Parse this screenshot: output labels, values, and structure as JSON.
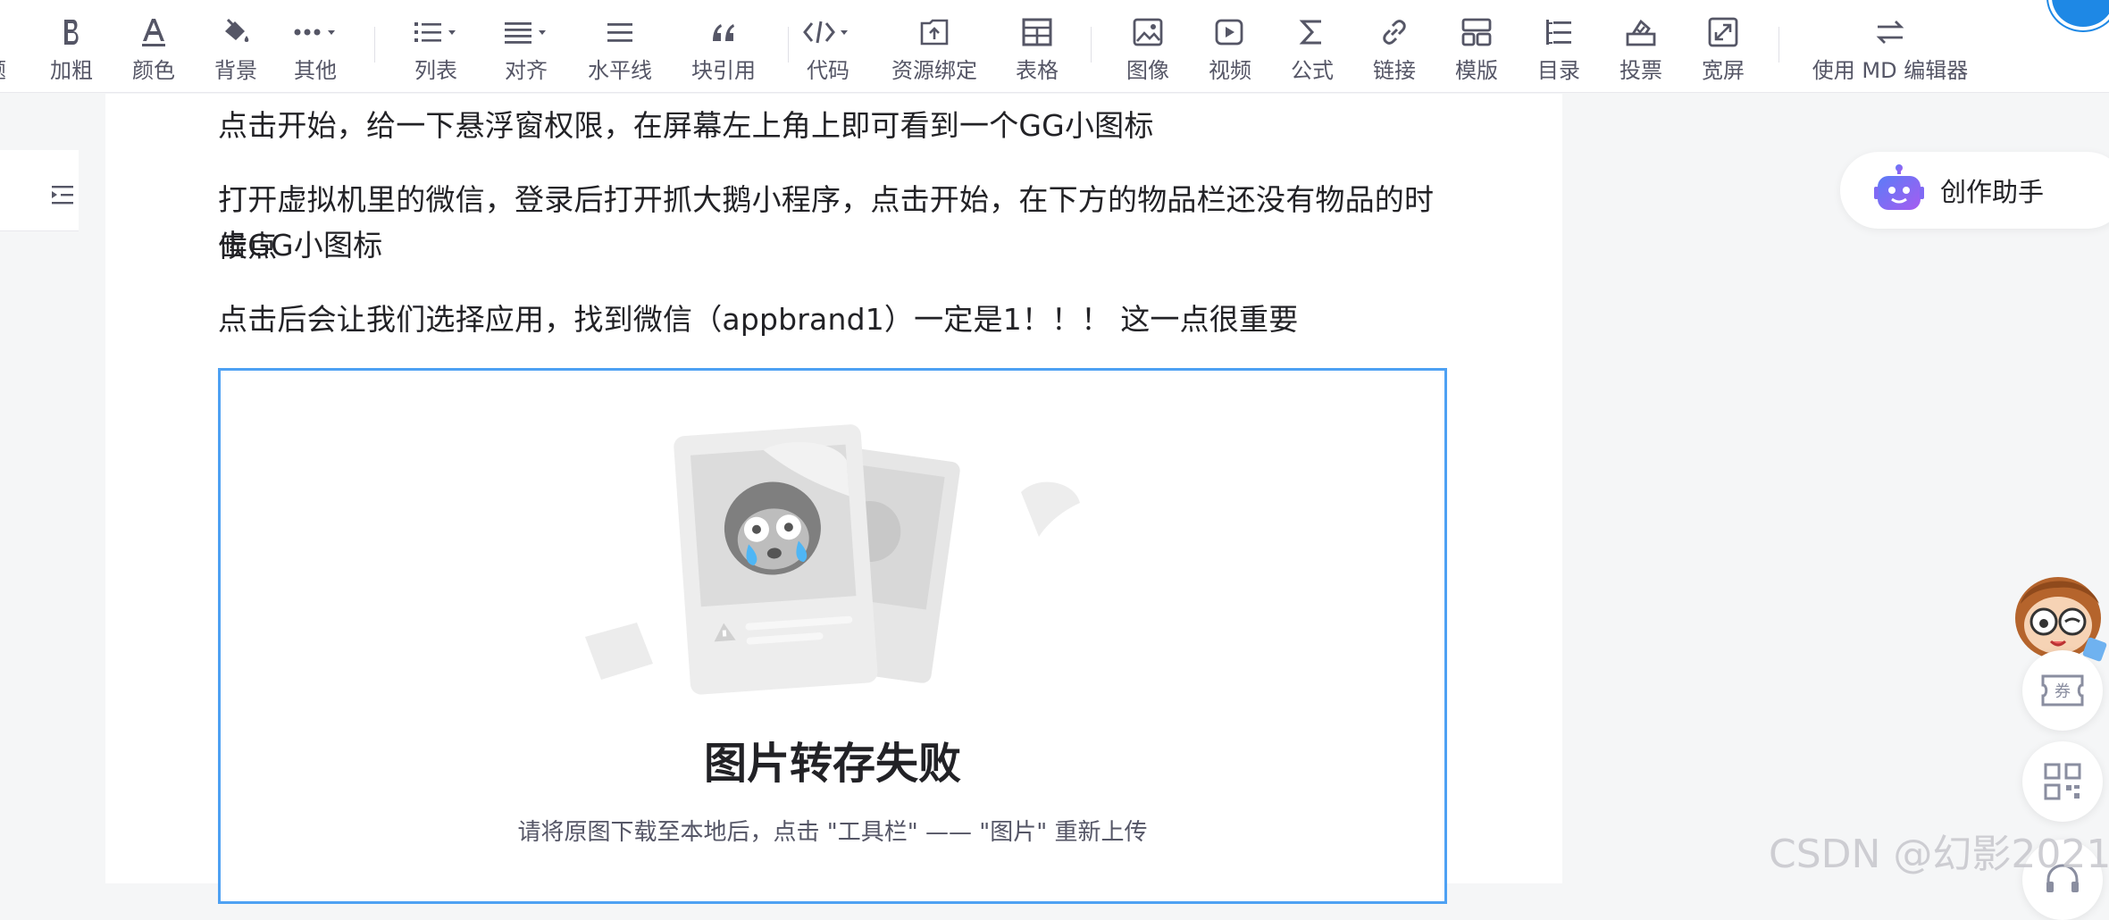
{
  "toolbar": {
    "items": [
      {
        "label": "题",
        "icon": "heading-dropdown-icon"
      },
      {
        "label": "加粗",
        "icon": "bold-icon"
      },
      {
        "label": "颜色",
        "icon": "font-color-icon"
      },
      {
        "label": "背景",
        "icon": "paint-bucket-icon"
      },
      {
        "label": "其他",
        "icon": "more-dots-icon"
      },
      {
        "label": "列表",
        "icon": "list-icon"
      },
      {
        "label": "对齐",
        "icon": "align-icon"
      },
      {
        "label": "水平线",
        "icon": "horizontal-rule-icon"
      },
      {
        "label": "块引用",
        "icon": "quote-icon"
      },
      {
        "label": "代码",
        "icon": "code-icon"
      },
      {
        "label": "资源绑定",
        "icon": "resource-upload-icon"
      },
      {
        "label": "表格",
        "icon": "table-icon"
      },
      {
        "label": "图像",
        "icon": "image-icon"
      },
      {
        "label": "视频",
        "icon": "video-icon"
      },
      {
        "label": "公式",
        "icon": "sigma-icon"
      },
      {
        "label": "链接",
        "icon": "link-icon"
      },
      {
        "label": "模版",
        "icon": "template-icon"
      },
      {
        "label": "目录",
        "icon": "toc-icon"
      },
      {
        "label": "投票",
        "icon": "vote-icon"
      },
      {
        "label": "宽屏",
        "icon": "widescreen-icon"
      },
      {
        "label": "使用 MD 编辑器",
        "icon": "switch-editor-icon"
      }
    ]
  },
  "content": {
    "paragraphs": [
      "点击开始，给一下悬浮窗权限，在屏幕左上角上即可看到一个GG小图标",
      "打开虚拟机里的微信，登录后打开抓大鹅小程序，点击开始，在下方的物品栏还没有物品的时候点",
      "击GG小图标",
      "点击后会让我们选择应用，找到微信（appbrand1）一定是1！！！ 这一点很重要"
    ],
    "image_error": {
      "title": "图片转存失败",
      "description": "请将原图下载至本地后，点击 \"工具栏\" —— \"图片\" 重新上传"
    }
  },
  "assistant": {
    "label": "创作助手"
  },
  "floating": {
    "coupon": "券"
  },
  "watermark": "CSDN @幻影2021",
  "colors": {
    "accent": "#4ea1f3",
    "assistant": "#6d5cf6",
    "text": "#222226"
  }
}
